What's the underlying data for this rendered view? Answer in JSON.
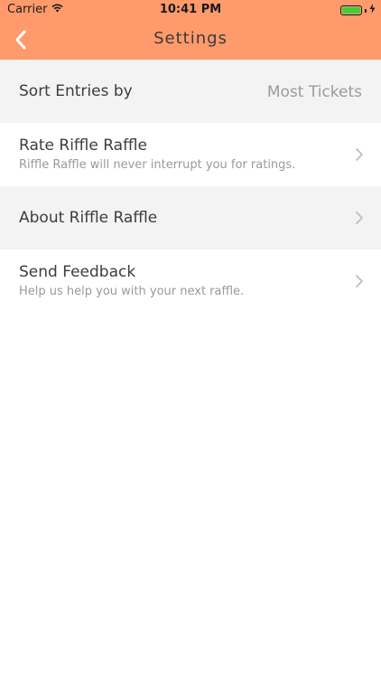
{
  "status_bar": {
    "carrier": "Carrier",
    "time": "10:41 PM",
    "battery_level": 1.0,
    "battery_color": "#3cd13c"
  },
  "nav": {
    "title": "Settings",
    "back_icon": "chevron-left-icon",
    "background_color": "#FF9A6C"
  },
  "settings": {
    "sort": {
      "label": "Sort Entries by",
      "value": "Most Tickets"
    },
    "rate": {
      "title": "Rate Riffle Raffle",
      "subtitle": "Riffle Raffle will never interrupt you for ratings."
    },
    "about": {
      "title": "About Riffle Raffle"
    },
    "feedback": {
      "title": "Send Feedback",
      "subtitle": "Help us help you with your next raffle."
    }
  }
}
